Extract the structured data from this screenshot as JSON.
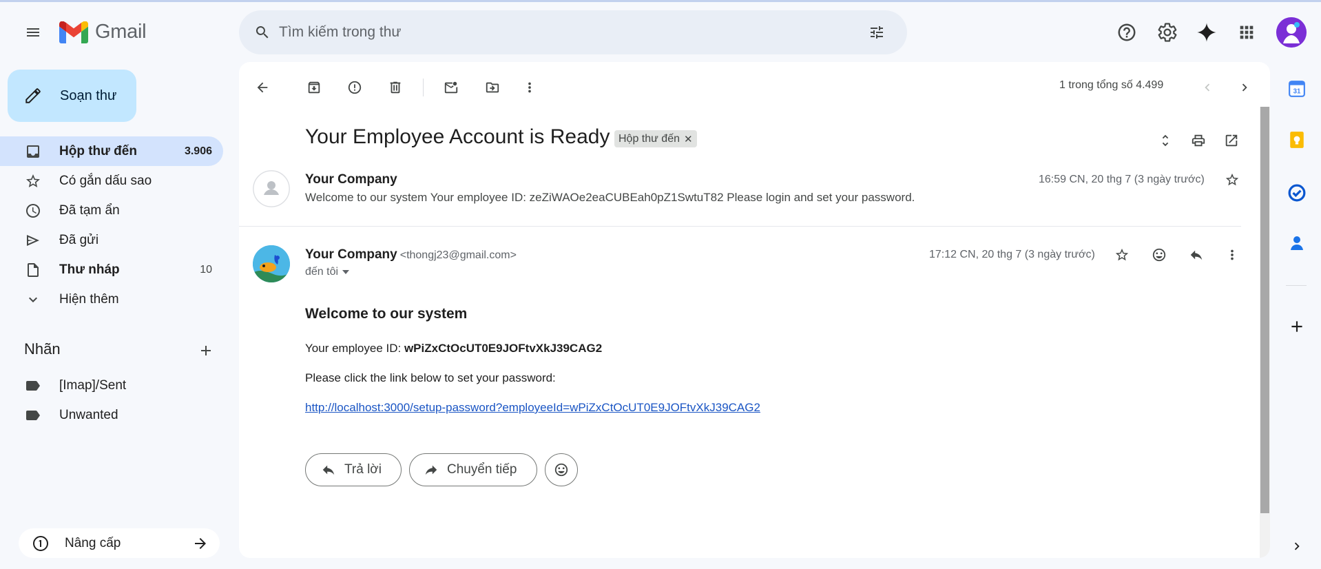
{
  "header": {
    "app_name": "Gmail",
    "search_placeholder": "Tìm kiếm trong thư"
  },
  "sidebar": {
    "compose_label": "Soạn thư",
    "items": [
      {
        "label": "Hộp thư đến",
        "count": "3.906",
        "icon": "inbox-icon"
      },
      {
        "label": "Có gắn dấu sao",
        "count": "",
        "icon": "star-icon"
      },
      {
        "label": "Đã tạm ẩn",
        "count": "",
        "icon": "clock-icon"
      },
      {
        "label": "Đã gửi",
        "count": "",
        "icon": "send-icon"
      },
      {
        "label": "Thư nháp",
        "count": "10",
        "icon": "draft-icon"
      },
      {
        "label": "Hiện thêm",
        "count": "",
        "icon": "chevron-down-icon"
      }
    ],
    "labels_title": "Nhãn",
    "labels": [
      "[Imap]/Sent",
      "Unwanted"
    ],
    "upgrade_label": "Nâng cấp"
  },
  "toolbar": {
    "pager_text": "1 trong tổng số 4.499"
  },
  "thread": {
    "subject": "Your Employee Account is Ready",
    "label_chip": "Hộp thư đến",
    "collapsed_message": {
      "sender": "Your Company",
      "snippet": "Welcome to our system Your employee ID: zeZiWAOe2eaCUBEah0pZ1SwtuT82 Please login and set your password.",
      "time": "16:59 CN, 20 thg 7 (3 ngày trước)"
    },
    "open_message": {
      "sender": "Your Company",
      "sender_email": "<thongj23@gmail.com>",
      "to": "đến tôi",
      "time": "17:12 CN, 20 thg 7 (3 ngày trước)",
      "heading": "Welcome to our system",
      "id_label": "Your employee ID: ",
      "employee_id": "wPiZxCtOcUT0E9JOFtvXkJ39CAG2",
      "instruction": "Please click the link below to set your password:",
      "link": "http://localhost:3000/setup-password?employeeId=wPiZxCtOcUT0E9JOFtvXkJ39CAG2"
    },
    "actions": {
      "reply": "Trả lời",
      "forward": "Chuyển tiếp"
    }
  },
  "colors": {
    "accent": "#0b57d0",
    "active_nav": "#d3e3fd",
    "compose_bg": "#c2e7ff",
    "link": "#1a55c4"
  }
}
